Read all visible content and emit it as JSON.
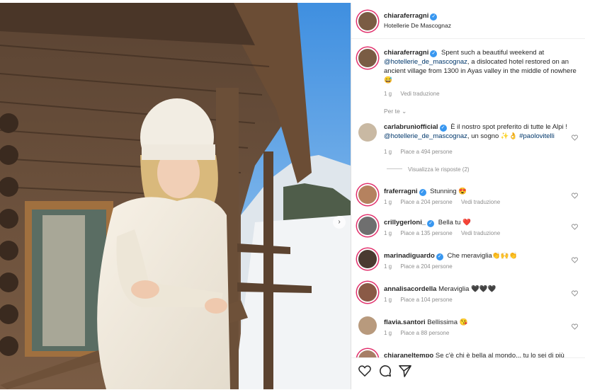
{
  "header": {
    "username": "chiaraferragni",
    "location": "Hotellerie De Mascognaz"
  },
  "caption": {
    "username": "chiaraferragni",
    "text": "Spent such a beautiful weekend at",
    "mention": "@hotellerie_de_mascognaz",
    "text2": ", a dislocated hotel restored on an ancient village from 1300 in Ayas valley in the middle of nowhere 😅",
    "time": "1 g",
    "translate": "Vedi traduzione"
  },
  "filter_label": "Per te",
  "comments": [
    {
      "username": "carlabrunìofficial",
      "verified": true,
      "text": "È il nostro spot preferito di tutte le Alpi !",
      "line2_mention": "@hotellerie_de_mascognaz",
      "line2_text": ", un sogno ✨👌",
      "line2_tag": "#paolovitelli",
      "time": "1 g",
      "likes": "Piace a 494 persone",
      "replies": "Visualizza le risposte (2)"
    },
    {
      "username": "fraferragni",
      "verified": true,
      "text": "Stunning 😍",
      "time": "1 g",
      "likes": "Piace a 204 persone",
      "translate": "Vedi traduzione"
    },
    {
      "username": "crillygerloni_",
      "verified": true,
      "text": "Bella tu ❤️",
      "time": "1 g",
      "likes": "Piace a 135 persone",
      "translate": "Vedi traduzione"
    },
    {
      "username": "marinadiguardo",
      "verified": true,
      "text": "Che meraviglia👏🙌👏",
      "time": "1 g",
      "likes": "Piace a 204 persone"
    },
    {
      "username": "annalisacordella",
      "verified": false,
      "text": "Meraviglia 🖤🖤🖤",
      "time": "1 g",
      "likes": "Piace a 104 persone"
    },
    {
      "username": "flavia.santori",
      "verified": false,
      "text": "Bellissima 😘",
      "time": "1 g",
      "likes": "Piace a 88 persone"
    },
    {
      "username": "chiaraneltempo",
      "verified": false,
      "text": "Se c'è chi è bella al mondo... tu lo sei di più"
    }
  ]
}
